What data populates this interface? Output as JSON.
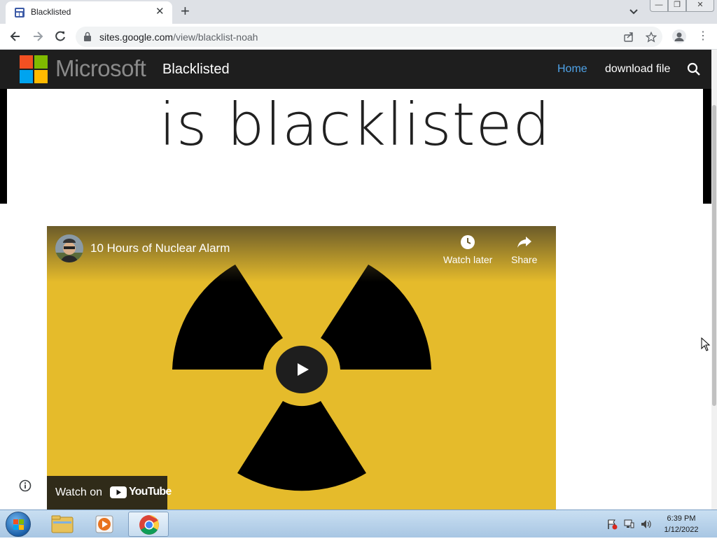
{
  "browser": {
    "tab": {
      "title": "Blacklisted",
      "close_label": "✕"
    },
    "new_tab_label": "+",
    "url_host": "sites.google.com",
    "url_path": "/view/blacklist-noah",
    "window_buttons": {
      "minimize": "—",
      "restore": "❐",
      "close": "✕"
    }
  },
  "site": {
    "brand": "Microsoft",
    "title": "Blacklisted",
    "nav": [
      {
        "label": "Home",
        "active": true
      },
      {
        "label": "download file",
        "active": false
      }
    ],
    "accent_color": "#4fa3e8",
    "hero_text": "is blacklisted"
  },
  "video": {
    "title": "10 Hours of Nuclear Alarm",
    "actions": [
      {
        "label": "Watch later",
        "icon": "clock-icon"
      },
      {
        "label": "Share",
        "icon": "share-icon"
      }
    ],
    "watch_on_label": "Watch on",
    "youtube_label": "YouTube",
    "background_color": "#e5bb2b"
  },
  "taskbar": {
    "time": "6:39 PM",
    "date": "1/12/2022",
    "apps": [
      "file-explorer",
      "media-player",
      "chrome"
    ]
  }
}
